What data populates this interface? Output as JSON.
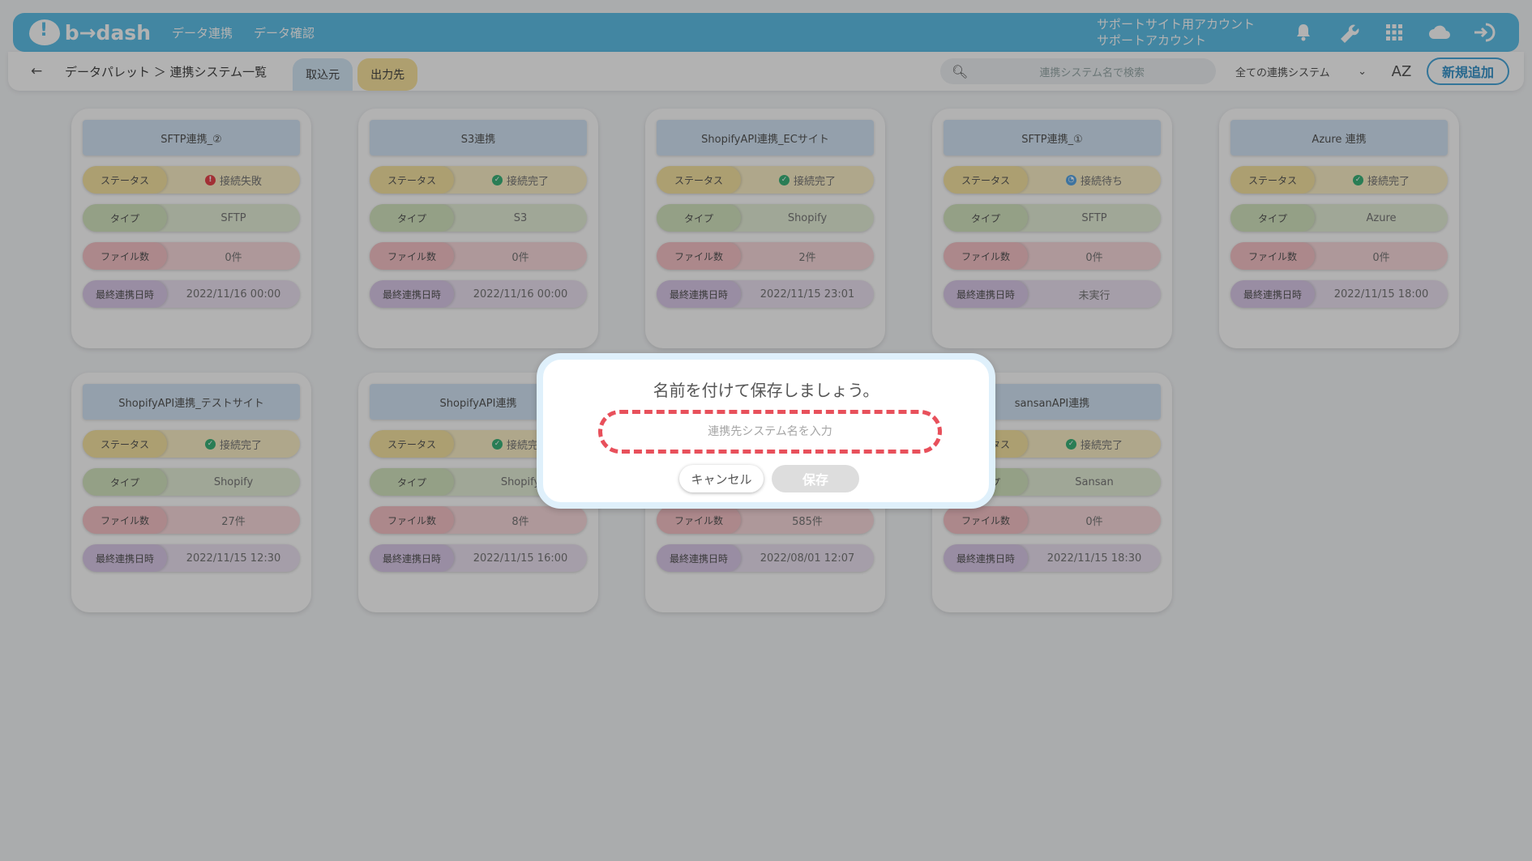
{
  "header": {
    "logo_text": "b→dash",
    "nav": [
      "データ連携",
      "データ確認"
    ],
    "account_line1": "サポートサイト用アカウント",
    "account_line2": "サポートアカウント",
    "icons": [
      "bell-icon",
      "wrench-icon",
      "grid-icon",
      "cloud-icon",
      "logout-icon"
    ]
  },
  "subbar": {
    "back_glyph": "←",
    "breadcrumb": "データパレット ＞ 連携システム一覧",
    "tab_in": "取込元",
    "tab_out": "出力先",
    "search_placeholder": "連携システム名で検索",
    "filter_value": "全ての連携システム",
    "sort_label": "AZ",
    "add_button": "新規追加"
  },
  "labels": {
    "status": "ステータス",
    "type": "タイプ",
    "files": "ファイル数",
    "last": "最終連携日時"
  },
  "cards": [
    {
      "title": "SFTP連携_②",
      "status": "接続失敗",
      "status_kind": "err",
      "type": "SFTP",
      "files": "0件",
      "last": "2022/11/16 00:00"
    },
    {
      "title": "S3連携",
      "status": "接続完了",
      "status_kind": "ok",
      "type": "S3",
      "files": "0件",
      "last": "2022/11/16 00:00"
    },
    {
      "title": "ShopifyAPI連携_ECサイト",
      "status": "接続完了",
      "status_kind": "ok",
      "type": "Shopify",
      "files": "2件",
      "last": "2022/11/15 23:01"
    },
    {
      "title": "SFTP連携_①",
      "status": "接続待ち",
      "status_kind": "wait",
      "type": "SFTP",
      "files": "0件",
      "last": "未実行"
    },
    {
      "title": "Azure 連携",
      "status": "接続完了",
      "status_kind": "ok",
      "type": "Azure",
      "files": "0件",
      "last": "2022/11/15 18:00"
    },
    {
      "title": "ShopifyAPI連携_テストサイト",
      "status": "接続完了",
      "status_kind": "ok",
      "type": "Shopify",
      "files": "27件",
      "last": "2022/11/15 12:30"
    },
    {
      "title": "ShopifyAPI連携",
      "status": "接続完了",
      "status_kind": "ok",
      "type": "Shopify",
      "files": "8件",
      "last": "2022/11/15 16:00"
    },
    {
      "title": "",
      "status": "",
      "status_kind": "ok",
      "type": "",
      "files": "585件",
      "last": "2022/08/01 12:07"
    },
    {
      "title": "sansanAPI連携",
      "status": "接続完了",
      "status_kind": "ok",
      "type": "Sansan",
      "files": "0件",
      "last": "2022/11/15 18:30"
    }
  ],
  "modal": {
    "title": "名前を付けて保存しましょう。",
    "input_placeholder": "連携先システム名を入力",
    "input_value": "",
    "cancel": "キャンセル",
    "save": "保存"
  }
}
